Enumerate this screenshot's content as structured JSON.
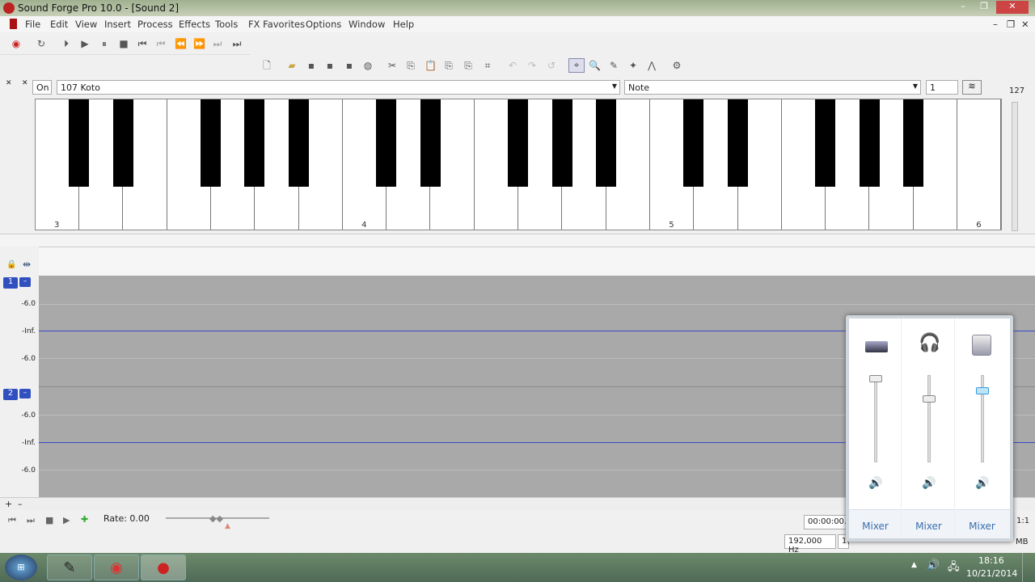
{
  "window": {
    "title": "Sound Forge Pro 10.0 - [Sound 2]"
  },
  "menu": [
    "File",
    "Edit",
    "View",
    "Insert",
    "Process",
    "Effects",
    "Tools",
    "FX Favorites",
    "Options",
    "Window",
    "Help"
  ],
  "instrument": {
    "on_label": "On",
    "program": "107 Koto",
    "mode": "Note",
    "channel": "1",
    "velocity_max": "127"
  },
  "piano": {
    "octave_labels": [
      "3",
      "4",
      "5",
      "6"
    ]
  },
  "tracks": [
    {
      "number": "1",
      "labels": [
        "-6.0",
        "-Inf.",
        "-6.0"
      ]
    },
    {
      "number": "2",
      "labels": [
        "-6.0",
        "-Inf.",
        "-6.0"
      ]
    }
  ],
  "transport": {
    "rate": "Rate: 0.00",
    "time": "00:00:00.0",
    "zoom": "1:1"
  },
  "status": {
    "sample_rate": "192,000 Hz",
    "partial": "1(",
    "size": "MB"
  },
  "mixer": {
    "labels": [
      "Mixer",
      "Mixer",
      "Mixer"
    ],
    "levels": [
      1.0,
      0.75,
      0.85
    ]
  },
  "taskbar": {
    "time": "18:16",
    "date": "10/21/2014"
  },
  "colors": {
    "waveform_bg": "#a9a9a9",
    "zero_line": "#3949c9",
    "channel_badge": "#3050c0"
  }
}
